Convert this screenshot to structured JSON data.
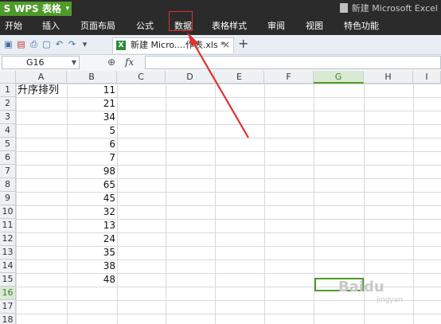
{
  "app": {
    "logo_letter": "S",
    "name": "WPS 表格",
    "dropdown_glyph": "▾",
    "window_title": "新建 Microsoft Excel"
  },
  "menu": {
    "items": [
      {
        "label": "开始",
        "key": "home"
      },
      {
        "label": "插入",
        "key": "insert"
      },
      {
        "label": "页面布局",
        "key": "page-layout"
      },
      {
        "label": "公式",
        "key": "formulas"
      },
      {
        "label": "数据",
        "key": "data"
      },
      {
        "label": "表格样式",
        "key": "table-style"
      },
      {
        "label": "审阅",
        "key": "review"
      },
      {
        "label": "视图",
        "key": "view"
      },
      {
        "label": "特色功能",
        "key": "features"
      }
    ],
    "highlighted": "数据"
  },
  "toolbar": {
    "icons": [
      "save-icon",
      "pdf-icon",
      "print-icon",
      "print-preview-icon",
      "undo-icon",
      "redo-icon",
      "customize-icon"
    ],
    "doc_tab": {
      "label": "新建 Micro....作表.xls *",
      "badge": "X",
      "close": "×"
    },
    "new_tab": "+"
  },
  "formula_bar": {
    "name_box": "G16",
    "zoom_glyph": "⊕",
    "fx": "fx",
    "value": ""
  },
  "sheet": {
    "columns": [
      "A",
      "B",
      "C",
      "D",
      "E",
      "F",
      "G",
      "H",
      "I"
    ],
    "active_column": "G",
    "rows": [
      "1",
      "2",
      "3",
      "4",
      "5",
      "6",
      "7",
      "8",
      "9",
      "10",
      "11",
      "12",
      "13",
      "14",
      "15",
      "16",
      "17",
      "18"
    ],
    "active_row": "16",
    "cells": {
      "A1": "升序排列",
      "B": [
        11,
        21,
        34,
        5,
        6,
        7,
        98,
        65,
        45,
        32,
        13,
        24,
        35,
        38,
        48
      ]
    },
    "selected_cell": "G16"
  },
  "watermark": {
    "text": "Baidu",
    "sub": "jingyan"
  },
  "colors": {
    "accent": "#4e9a2a",
    "titlebar": "#2b2b2b",
    "annotation": "#e03030"
  }
}
